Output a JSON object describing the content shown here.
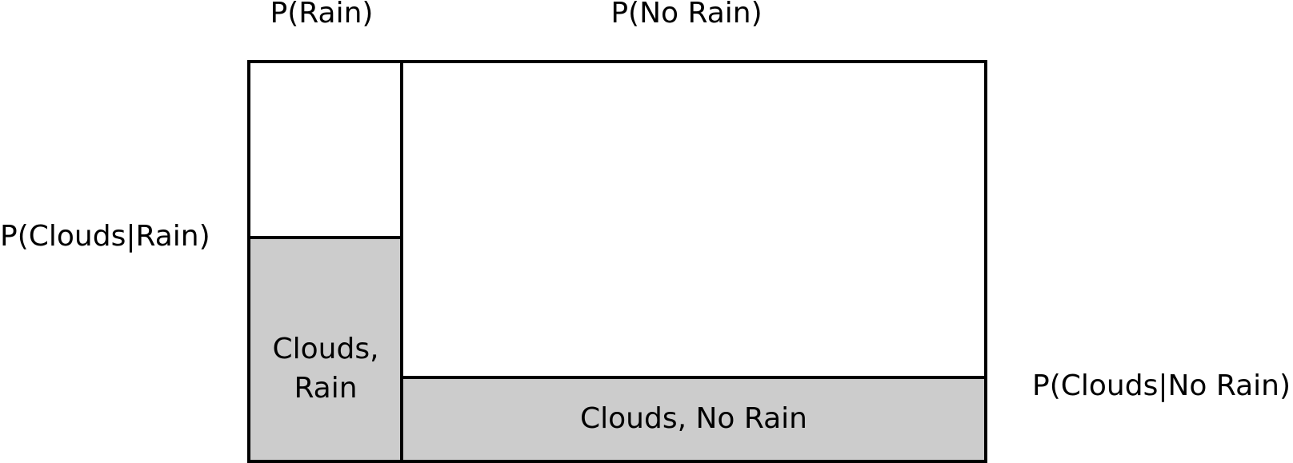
{
  "labels": {
    "p_rain": "P(Rain)",
    "p_no_rain": "P(No Rain)",
    "p_clouds_given_rain": "P(Clouds|Rain)",
    "p_clouds_given_no_rain": "P(Clouds|No Rain)"
  },
  "regions": {
    "clouds_rain_line1": "Clouds,",
    "clouds_rain_line2": "Rain",
    "clouds_no_rain": "Clouds, No Rain"
  },
  "colors": {
    "shaded": "#cccccc",
    "border": "#000000"
  }
}
